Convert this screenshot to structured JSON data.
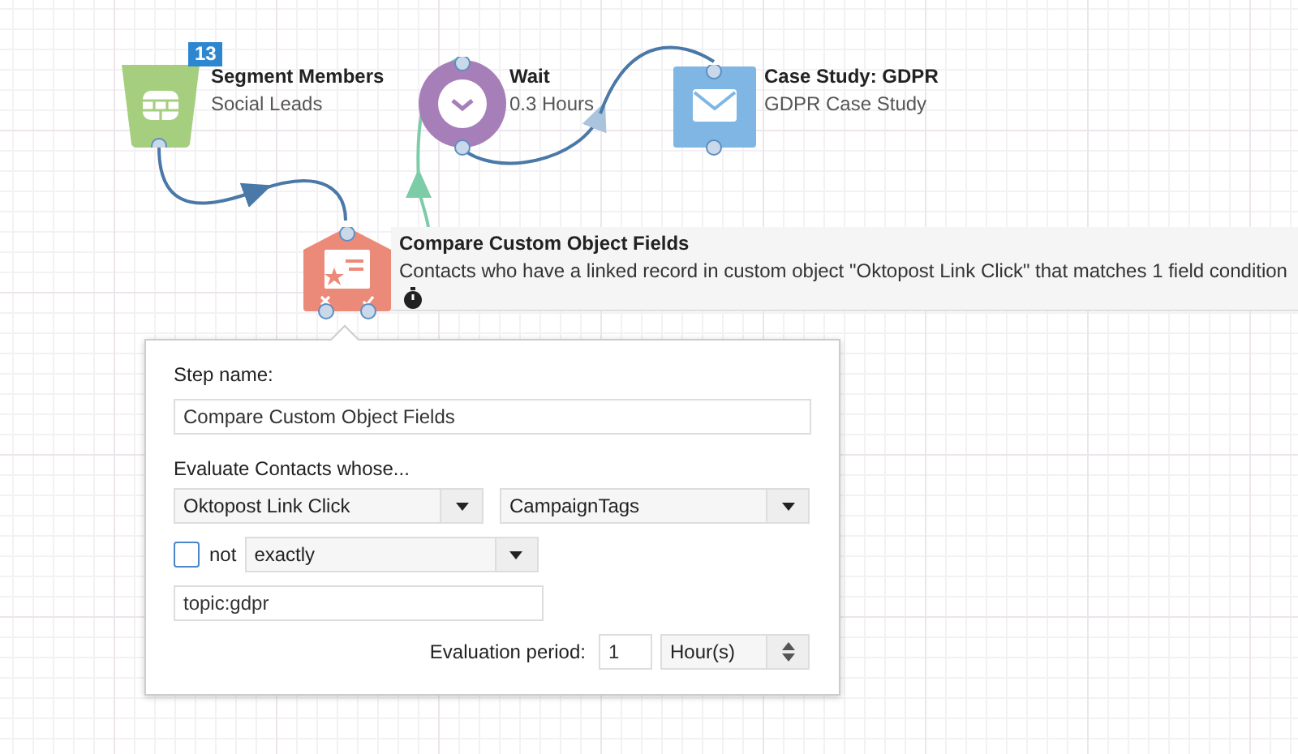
{
  "nodes": [
    {
      "kind": "segment",
      "title": "Segment Members",
      "subtitle": "Social Leads",
      "badge": "13"
    },
    {
      "kind": "wait",
      "title": "Wait",
      "subtitle": "0.3 Hours"
    },
    {
      "kind": "email",
      "title": "Case Study: GDPR",
      "subtitle": "GDPR Case Study"
    },
    {
      "kind": "compare",
      "title": "Compare Custom Object Fields",
      "subtitle": "Contacts who have a linked record in custom object \"Oktopost Link Click\" that matches 1 field condition"
    }
  ],
  "popup": {
    "step_name_label": "Step name:",
    "step_name": "Compare Custom Object Fields",
    "evaluate_label": "Evaluate Contacts whose...",
    "object_select": "Oktopost Link Click",
    "field_select": "CampaignTags",
    "not_label": "not",
    "not_checked": false,
    "operator_select": "exactly",
    "value": "topic:gdpr",
    "period_label": "Evaluation period:",
    "period_value": "1",
    "period_unit": "Hour(s)"
  }
}
